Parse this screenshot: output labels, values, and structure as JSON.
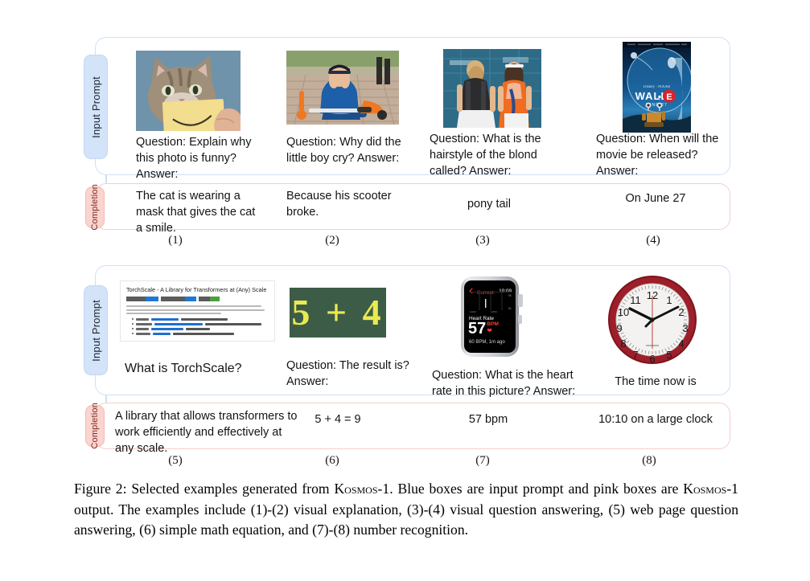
{
  "figure": {
    "caption_runs": [
      {
        "t": "Figure 2: Selected examples generated from ",
        "sc": false
      },
      {
        "t": "Kosmos-1",
        "sc": true
      },
      {
        "t": ". Blue boxes are input prompt and pink boxes are ",
        "sc": false
      },
      {
        "t": "Kosmos-1",
        "sc": true
      },
      {
        "t": " output.  The examples include (1)-(2) visual explanation, (3)-(4) visual question answering, (5) web page question answering, (6) simple math equation, and (7)-(8) number recognition.",
        "sc": false
      }
    ],
    "caption_plain": "Figure 2: Selected examples generated from Kosmos-1. Blue boxes are input prompt and pink boxes are Kosmos-1 output.  The examples include (1)-(2) visual explanation, (3)-(4) visual question answering, (5) web page question answering, (6) simple math equation, and (7)-(8) number recognition."
  },
  "labels": {
    "input_prompt": "Input Prompt",
    "completion": "Completion"
  },
  "colors": {
    "prompt_border": "#cfe0f5",
    "prompt_tab_fill": "#d3e3f8",
    "completion_border": "#f6cfcb",
    "completion_tab_fill": "#fbd4cf",
    "chalkboard": "#3d5c47",
    "chalk_text": "#eaea4f",
    "watch_accent": "#ff3b30",
    "clock_rim": "#9d1f2a"
  },
  "examples": [
    {
      "index": "(1)",
      "image_name": "cat-with-smiley-note-photo",
      "prompt": "Question: Explain why this photo is funny? Answer:",
      "completion": "The cat is wearing a mask that gives the cat a smile.",
      "completion_align": "left"
    },
    {
      "index": "(2)",
      "image_name": "crying-boy-with-scooter-photo",
      "prompt": "Question: Why did the little boy cry? Answer:",
      "completion": "Because his scooter broke.",
      "completion_align": "left"
    },
    {
      "index": "(3)",
      "image_name": "tennis-players-photo",
      "prompt": "Question: What is the hairstyle of the blond called? Answer:",
      "completion": "pony tail",
      "completion_align": "center"
    },
    {
      "index": "(4)",
      "image_name": "wall-e-movie-poster",
      "prompt": "Question: When will the movie be released? Answer:",
      "completion": "On June 27",
      "completion_align": "center"
    },
    {
      "index": "(5)",
      "image_name": "torchscale-webpage-screenshot",
      "prompt": "What is TorchScale?",
      "completion": "A library that allows transformers to work efficiently and effectively at any scale.",
      "completion_align": "left"
    },
    {
      "index": "(6)",
      "image_name": "chalkboard-math-equation",
      "prompt": "Question: The result is? Answer:",
      "completion": "5 + 4 = 9",
      "completion_align": "center"
    },
    {
      "index": "(7)",
      "image_name": "apple-watch-heart-rate-screenshot",
      "prompt": "Question: What is the heart rate in this picture? Answer:",
      "completion": "57 bpm",
      "completion_align": "center"
    },
    {
      "index": "(8)",
      "image_name": "red-wall-clock-photo",
      "prompt": "The time now is",
      "completion": "10:10 on a large clock",
      "completion_align": "center"
    }
  ],
  "walle_poster": {
    "title": "WALL·E",
    "subtitle": "JUNE 27",
    "studio": "Disney · PIXAR"
  },
  "webpage": {
    "title": "TorchScale - A Library for Transformers at (Any) Scale"
  },
  "chalkboard": {
    "equation": "5 + 4"
  },
  "watch": {
    "back_label": "Current",
    "clock_time": "10:09",
    "metric_label": "Heart Rate",
    "value": "57",
    "unit": "BPM",
    "footnote": "60 BPM, 1m ago"
  },
  "wall_clock": {
    "numerals": [
      "12",
      "1",
      "2",
      "3",
      "4",
      "5",
      "6",
      "7",
      "8",
      "9",
      "10",
      "11"
    ],
    "display_time": "10:10"
  }
}
